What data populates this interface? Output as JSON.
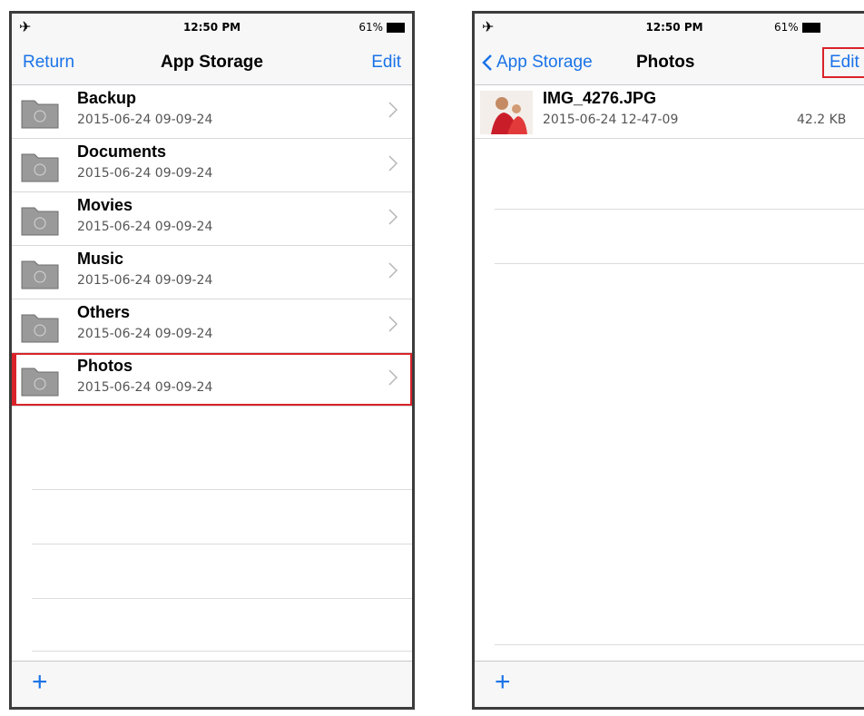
{
  "left": {
    "status": {
      "time": "12:50 PM",
      "battery": "61%"
    },
    "nav": {
      "left": "Return",
      "title": "App Storage",
      "right": "Edit"
    },
    "folders": [
      {
        "name": "Backup",
        "date": "2015-06-24 09-09-24"
      },
      {
        "name": "Documents",
        "date": "2015-06-24 09-09-24"
      },
      {
        "name": "Movies",
        "date": "2015-06-24 09-09-24"
      },
      {
        "name": "Music",
        "date": "2015-06-24 09-09-24"
      },
      {
        "name": "Others",
        "date": "2015-06-24 09-09-24"
      },
      {
        "name": "Photos",
        "date": "2015-06-24 09-09-24"
      }
    ],
    "toolbar": {
      "add": "+"
    }
  },
  "right": {
    "status": {
      "time": "12:50 PM",
      "battery": "61%"
    },
    "nav": {
      "back": "App Storage",
      "title": "Photos",
      "right": "Edit"
    },
    "files": [
      {
        "name": "IMG_4276.JPG",
        "date": "2015-06-24 12-47-09",
        "size": "42.2 KB"
      }
    ],
    "toolbar": {
      "add": "+"
    }
  },
  "colors": {
    "accent": "#1a73e8",
    "highlight": "#d9232a"
  }
}
